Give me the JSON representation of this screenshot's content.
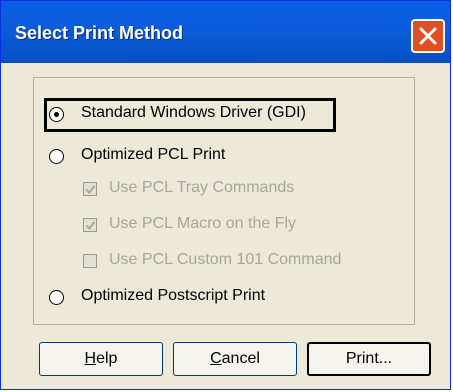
{
  "dialog": {
    "title": "Select Print Method"
  },
  "options": {
    "standard": {
      "label": "Standard Windows Driver (GDI)",
      "selected": true
    },
    "pcl": {
      "label": "Optimized PCL Print",
      "selected": false
    },
    "postscript": {
      "label": "Optimized Postscript Print",
      "selected": false
    }
  },
  "pcl_suboptions": {
    "tray": {
      "label": "Use PCL Tray Commands",
      "checked": true,
      "enabled": false
    },
    "macro": {
      "label": "Use PCL Macro on the Fly",
      "checked": true,
      "enabled": false
    },
    "custom101": {
      "label": "Use PCL Custom 101 Command",
      "checked": false,
      "enabled": false
    }
  },
  "buttons": {
    "help": {
      "mnemonic": "H",
      "rest": "elp"
    },
    "cancel": {
      "mnemonic": "C",
      "rest": "ancel"
    },
    "print": {
      "label": "Print..."
    }
  },
  "icons": {
    "close": "close-icon",
    "radio": "radio-button",
    "check": "checkmark-icon"
  },
  "colors": {
    "title_bar": "#0a5ee7",
    "close_button": "#e04e24",
    "dialog_face": "#ece9d8",
    "disabled_text": "#a7a59c"
  }
}
